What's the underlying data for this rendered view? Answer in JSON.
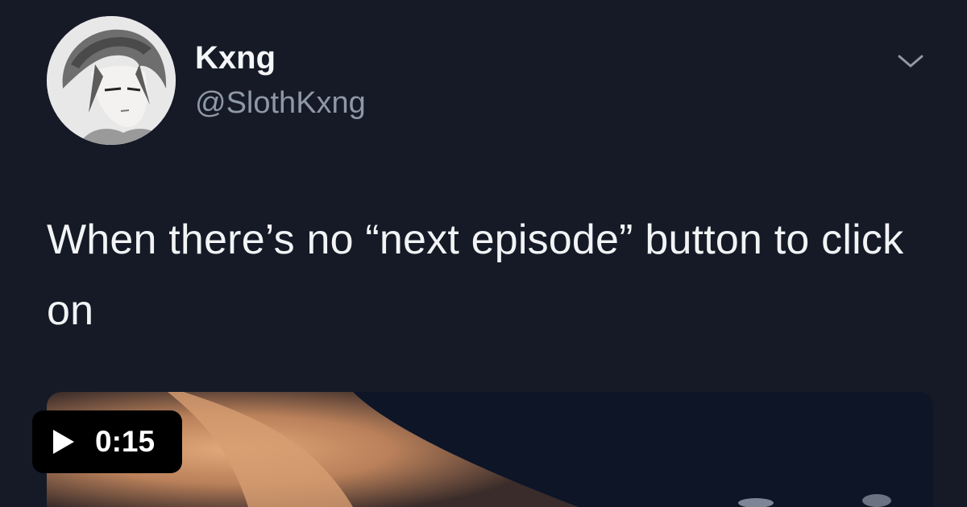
{
  "tweet": {
    "display_name": "Kxng",
    "handle": "@SlothKxng",
    "text": "When there’s no “next episode” button to click on",
    "avatar_icon": "anime-avatar",
    "menu_icon": "chevron-down-icon"
  },
  "video": {
    "duration": "0:15",
    "play_icon": "play-icon"
  },
  "colors": {
    "background": "#151a26",
    "handle": "#8e98a6",
    "badge": "#000000"
  }
}
